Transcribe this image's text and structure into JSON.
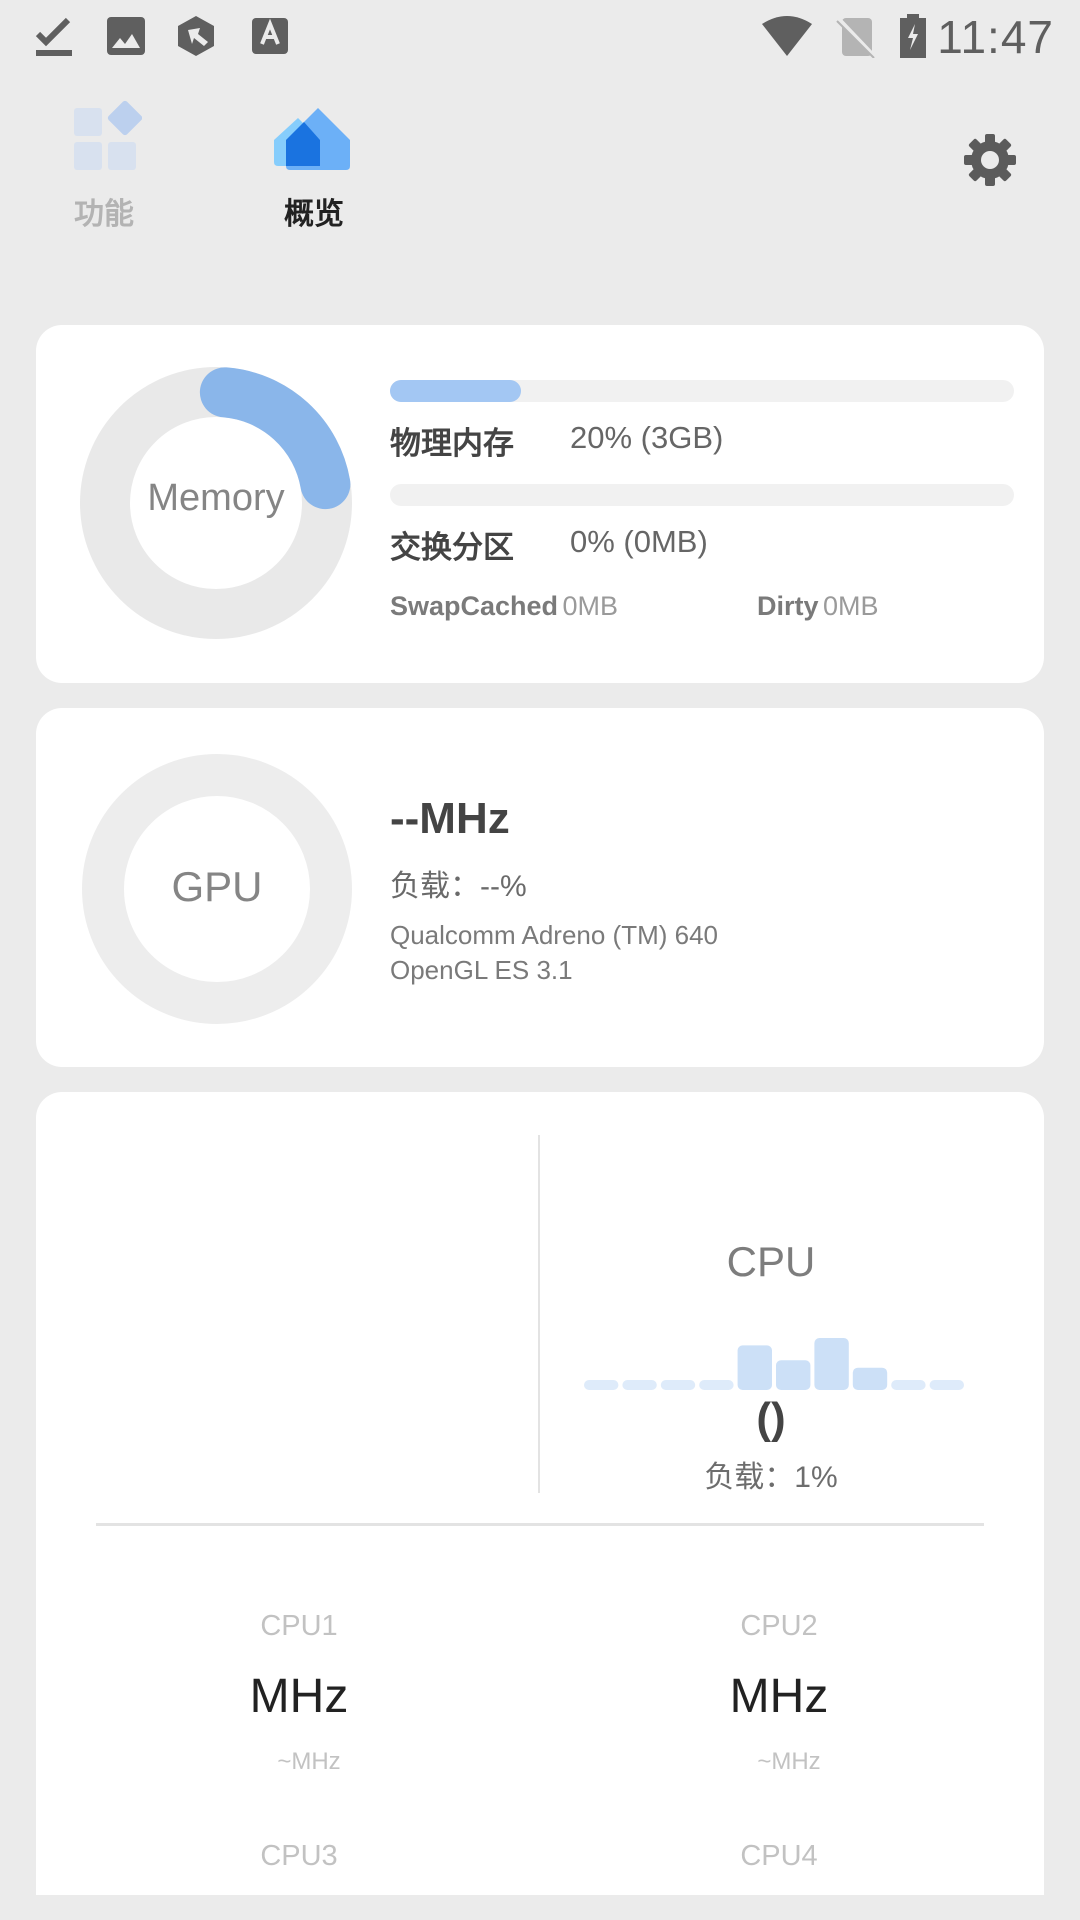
{
  "status_bar": {
    "time": "11:47",
    "left_icons": [
      "checkmark-download-icon",
      "image-icon",
      "shield-arrow-icon",
      "font-a-icon"
    ],
    "right_icons": [
      "wifi-icon",
      "no-sim-icon",
      "battery-charging-icon"
    ]
  },
  "tabs": [
    {
      "label": "功能",
      "icon": "grid-icon",
      "active": false
    },
    {
      "label": "概览",
      "icon": "home-icon",
      "active": true
    }
  ],
  "settings_icon": "gear-icon",
  "memory": {
    "donut_label": "Memory",
    "donut_percent": 21,
    "physical": {
      "label": "物理内存",
      "value": "20% (3GB)",
      "percent": 21
    },
    "swap": {
      "label": "交换分区",
      "value": "0% (0MB)",
      "percent": 0
    },
    "swap_cached": {
      "label": "SwapCached",
      "value": "0MB"
    },
    "dirty": {
      "label": "Dirty",
      "value": "0MB"
    },
    "accent_color": "#8ab6ea"
  },
  "gpu": {
    "donut_label": "GPU",
    "frequency": "--MHz",
    "load": "负载：--%",
    "renderer": "Qualcomm Adreno (TM) 640",
    "gl_version": "OpenGL ES 3.1"
  },
  "cpu": {
    "title": "CPU",
    "summary": "()",
    "load": "负载：1%",
    "history_bars": [
      1,
      1,
      1,
      1,
      6,
      4,
      7,
      3,
      1,
      1
    ],
    "cores": [
      {
        "name": "CPU1",
        "freq": "MHz",
        "range": "~MHz"
      },
      {
        "name": "CPU2",
        "freq": "MHz",
        "range": "~MHz"
      },
      {
        "name": "CPU3",
        "freq": "",
        "range": ""
      },
      {
        "name": "CPU4",
        "freq": "",
        "range": ""
      }
    ]
  }
}
